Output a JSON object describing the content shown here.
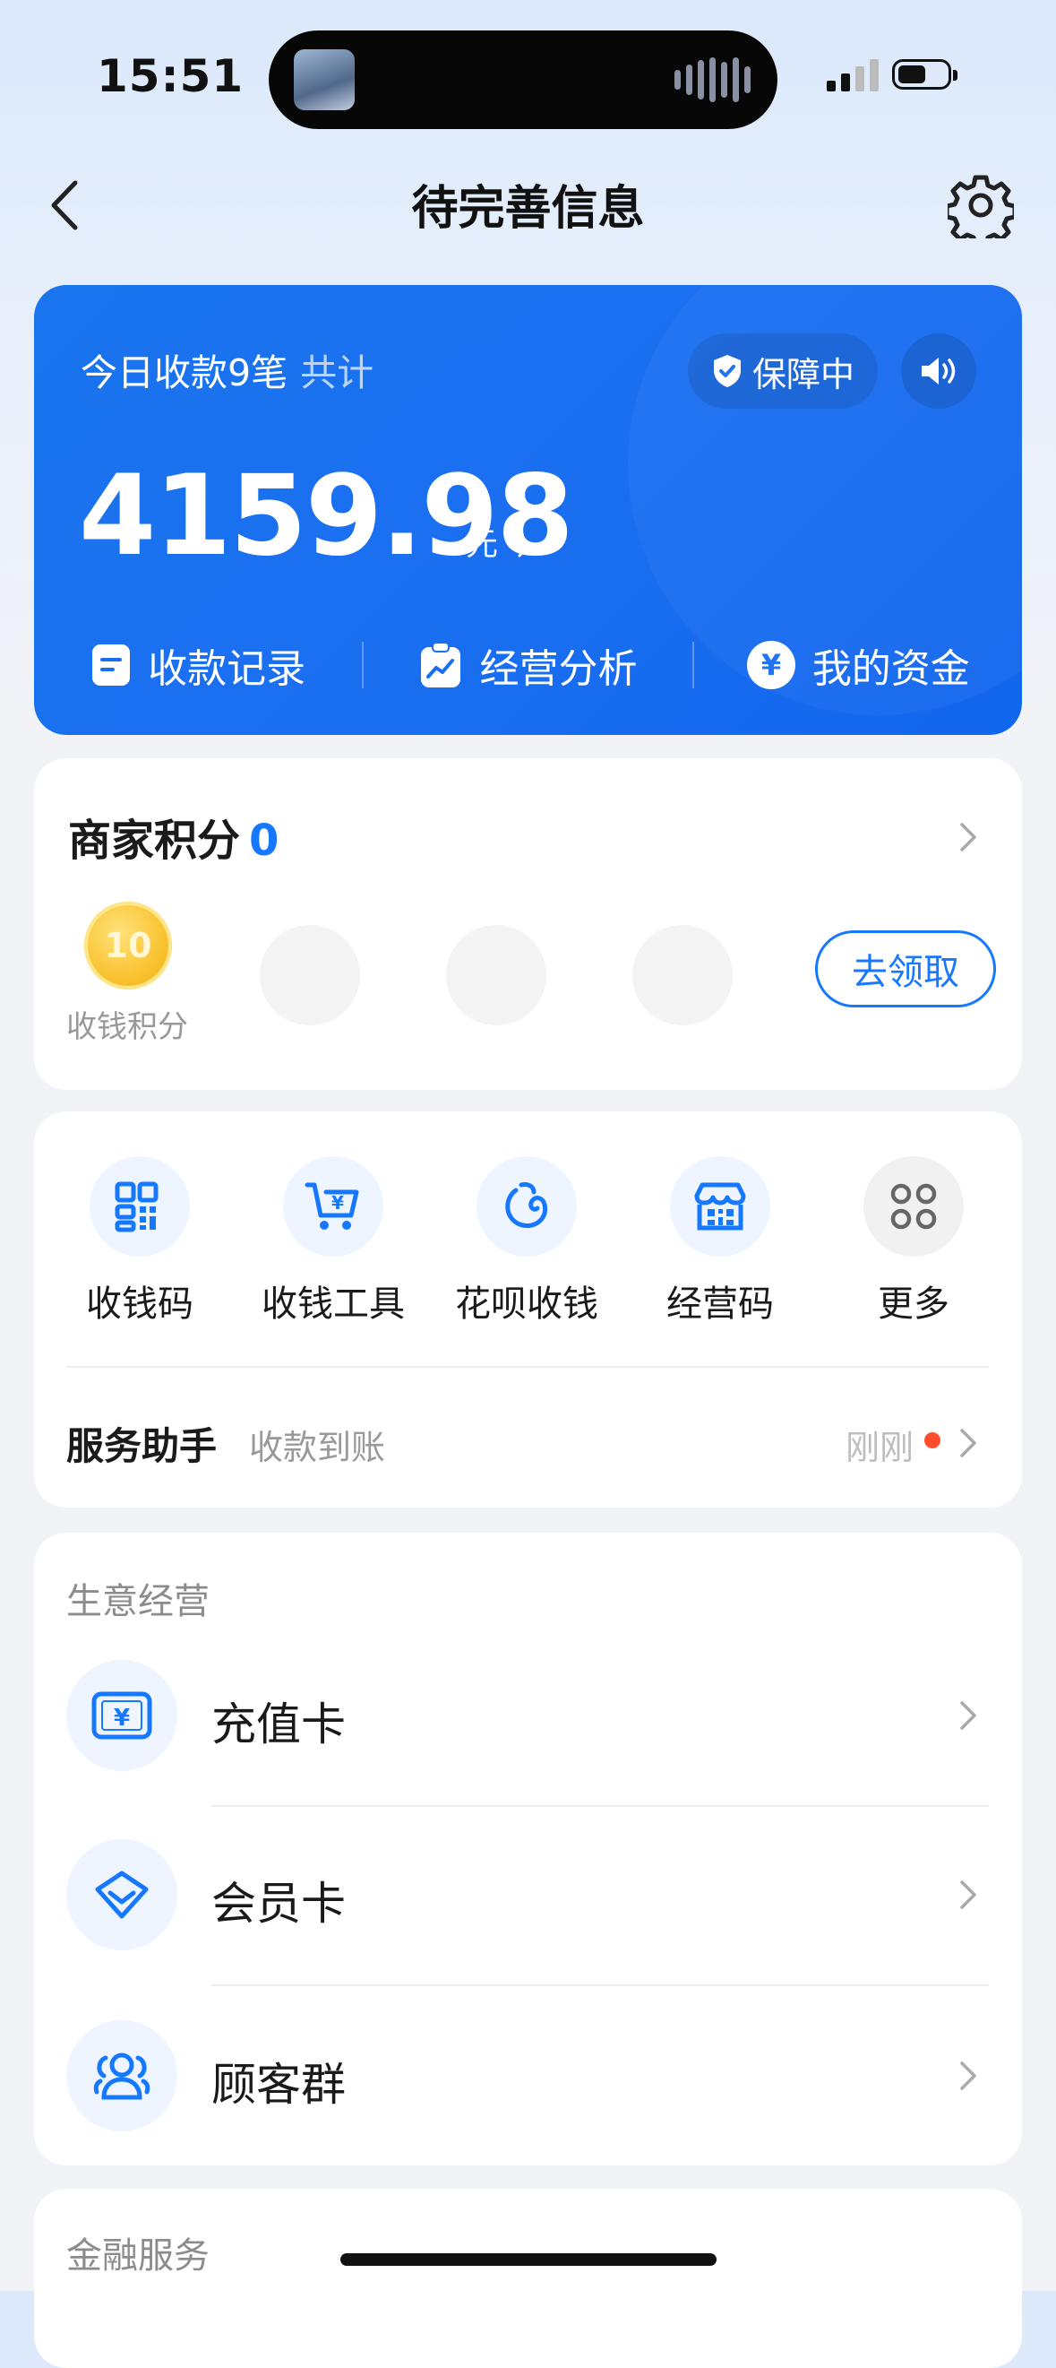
{
  "status_bar": {
    "time": "15:51"
  },
  "nav": {
    "title": "待完善信息"
  },
  "summary": {
    "today_prefix": "今日收款9笔",
    "today_total_label": "共计",
    "guard_label": "保障中",
    "amount": "4159.98",
    "unit": "元",
    "links": [
      {
        "label": "收款记录",
        "icon": "receipt-icon"
      },
      {
        "label": "经营分析",
        "icon": "analytics-icon"
      },
      {
        "label": "我的资金",
        "icon": "yuan-icon"
      }
    ]
  },
  "points": {
    "title": "商家积分",
    "value": "0",
    "coin_value": "10",
    "coin_label": "收钱积分",
    "claim_label": "去领取"
  },
  "tools": [
    {
      "label": "收钱码",
      "icon": "qr-grid-icon"
    },
    {
      "label": "收钱工具",
      "icon": "cart-yuan-icon"
    },
    {
      "label": "花呗收钱",
      "icon": "huabei-icon"
    },
    {
      "label": "经营码",
      "icon": "store-qr-icon"
    },
    {
      "label": "更多",
      "icon": "more-grid-icon"
    }
  ],
  "assistant": {
    "title": "服务助手",
    "subtitle": "收款到账",
    "time": "刚刚"
  },
  "business": {
    "section_title": "生意经营",
    "rows": [
      {
        "label": "充值卡",
        "icon": "recharge-card-icon"
      },
      {
        "label": "会员卡",
        "icon": "member-card-icon"
      },
      {
        "label": "顾客群",
        "icon": "customer-group-icon"
      }
    ]
  },
  "finance": {
    "section_title": "金融服务"
  },
  "colors": {
    "brand_blue": "#1677ff",
    "card_blue": "#1a74ee",
    "badge_red": "#ff4d2e"
  }
}
